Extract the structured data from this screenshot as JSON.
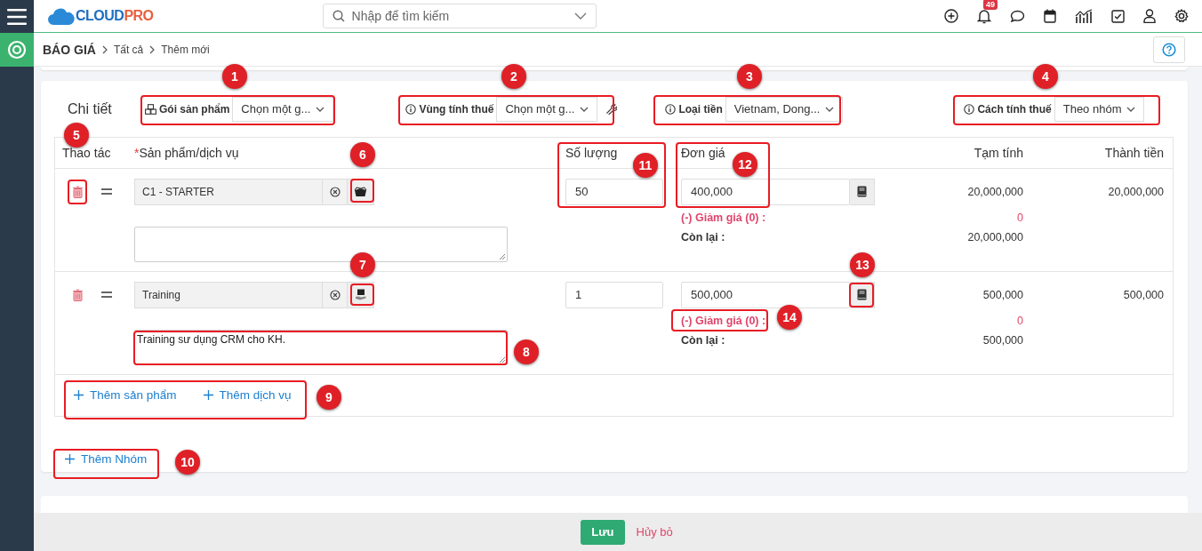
{
  "logo": {
    "main": "CLOUD",
    "accent": "PRO"
  },
  "search": {
    "placeholder": "Nhập để tìm kiếm"
  },
  "notifications": {
    "count": "49"
  },
  "breadcrumb": [
    {
      "label": "BÁO GIÁ"
    },
    {
      "label": "Tất cả"
    },
    {
      "label": "Thêm mới"
    }
  ],
  "section": {
    "title": "Chi tiết"
  },
  "settings": [
    {
      "kind": "bundle",
      "label": "Gói sản phẩm",
      "value": "Chọn một g...",
      "has_tool": false
    },
    {
      "kind": "info",
      "label": "Vùng tính thuế",
      "value": "Chọn một g...",
      "has_tool": true
    },
    {
      "kind": "info",
      "label": "Loại tiền",
      "value": "Vietnam, Dong...",
      "has_tool": false
    },
    {
      "kind": "info",
      "label": "Cách tính thuế",
      "value": "Theo nhóm",
      "has_tool": false
    }
  ],
  "table": {
    "columns": [
      {
        "label": "Thao tác"
      },
      {
        "label": "Sản phẩm/dịch vụ",
        "required_mark": "*"
      },
      {
        "label": "Số lượng"
      },
      {
        "label": "Đơn giá"
      },
      {
        "label": "Tạm tính"
      },
      {
        "label": "Thành tiền"
      }
    ],
    "rows": [
      {
        "kind": "product",
        "product": "C1 - STARTER",
        "quantity": "50",
        "unit_price": "400,000",
        "discount_label": "(-) Giảm giá (0) :",
        "discount": "0",
        "remaining_label": "Còn lại :",
        "subtotal": "20,000,000",
        "remaining": "20,000,000",
        "total": "20,000,000"
      },
      {
        "kind": "service",
        "product": "Training",
        "description": "Training sư dụng CRM cho KH.",
        "quantity": "1",
        "unit_price": "500,000",
        "discount_label": "(-) Giảm giá (0) :",
        "discount": "0",
        "remaining_label": "Còn lại :",
        "subtotal": "500,000",
        "remaining": "500,000",
        "total": "500,000"
      }
    ]
  },
  "add_links": [
    {
      "label": "Thêm sản phẩm"
    },
    {
      "label": "Thêm dịch vụ"
    }
  ],
  "add_group": {
    "label": "Thêm Nhóm"
  },
  "footer": {
    "save": "Lưu",
    "cancel": "Hủy bỏ"
  },
  "annotations": [
    {
      "number": "1"
    },
    {
      "number": "2"
    },
    {
      "number": "3"
    },
    {
      "number": "4"
    },
    {
      "number": "5"
    },
    {
      "number": "6"
    },
    {
      "number": "7"
    },
    {
      "number": "8"
    },
    {
      "number": "9"
    },
    {
      "number": "10"
    },
    {
      "number": "11"
    },
    {
      "number": "12"
    },
    {
      "number": "13"
    },
    {
      "number": "14"
    }
  ]
}
